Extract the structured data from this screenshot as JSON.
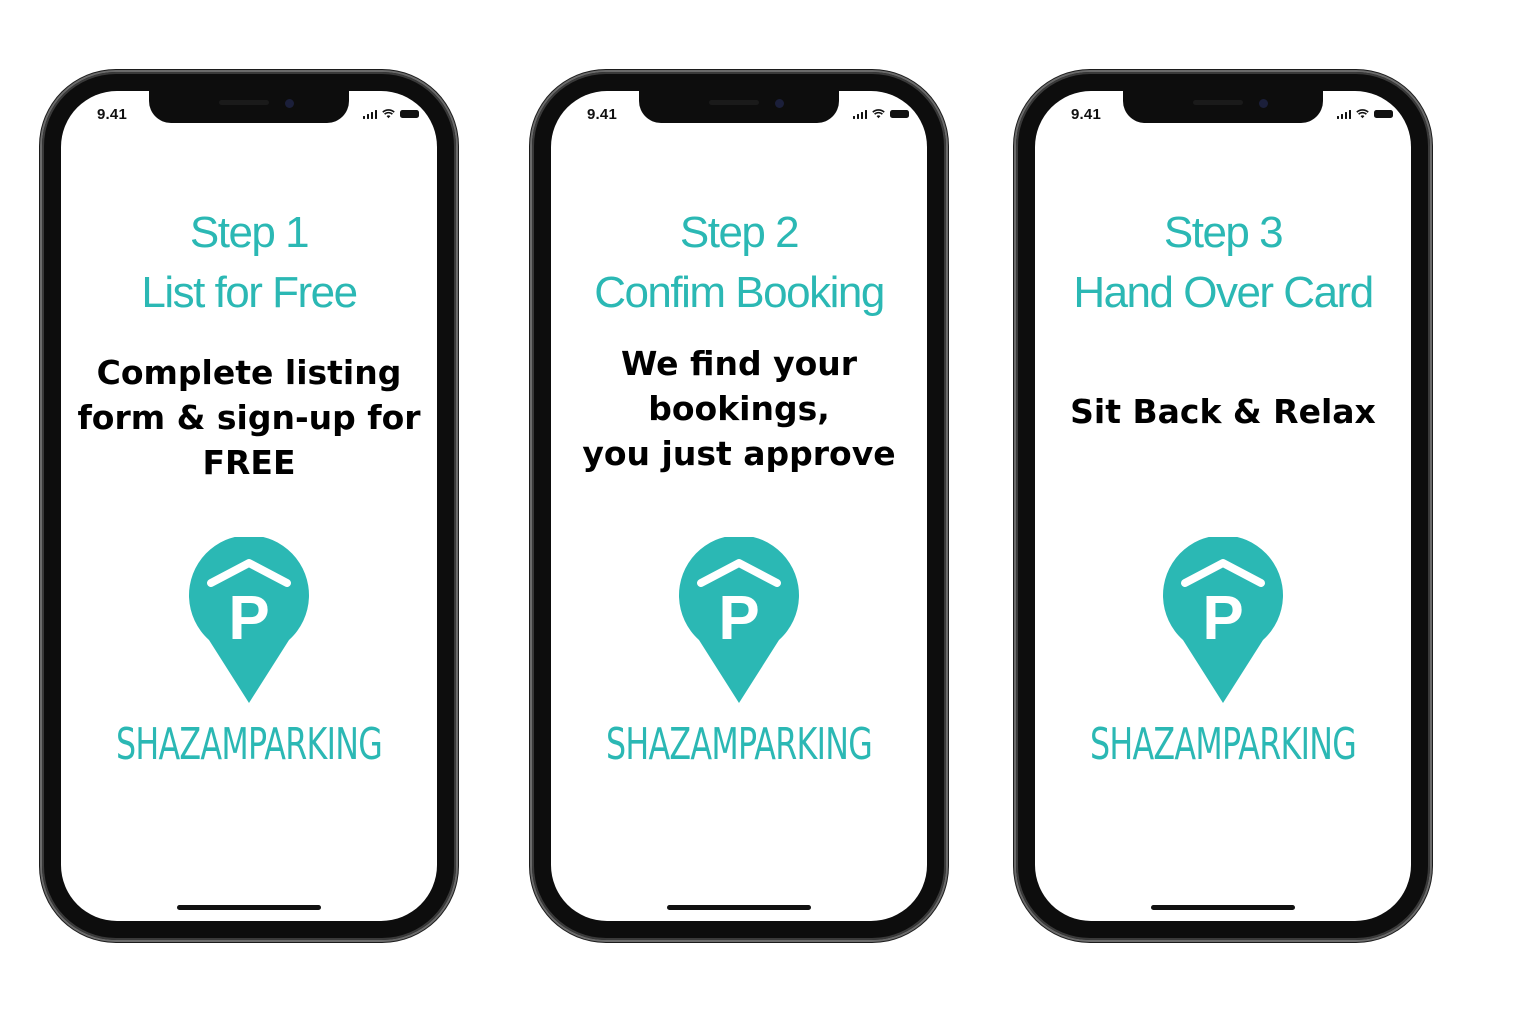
{
  "status_bar": {
    "time": "9.41"
  },
  "brand": {
    "name": "SHAZAMPARKING",
    "logo_letter": "P",
    "color": "#2bb8b4"
  },
  "phones": [
    {
      "step": "Step 1",
      "title": "List for Free",
      "description": [
        "Complete listing",
        "form & sign-up for",
        "FREE"
      ]
    },
    {
      "step": "Step 2",
      "title": "Confim Booking",
      "description": [
        "We find your",
        "bookings,",
        "you just approve"
      ]
    },
    {
      "step": "Step 3",
      "title": "Hand Over Card",
      "description": [
        "Sit Back & Relax"
      ]
    }
  ],
  "icons": [
    "signal-icon",
    "wifi-icon",
    "battery-icon",
    "parking-pin-icon"
  ]
}
